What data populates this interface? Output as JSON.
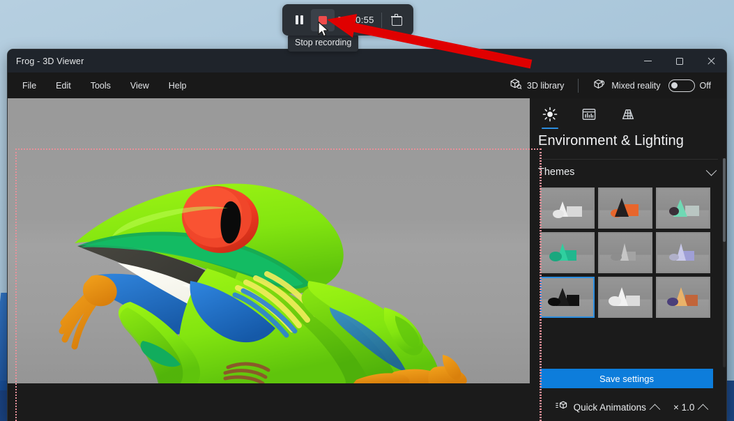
{
  "recording_toolbar": {
    "pause_label": "Pause recording",
    "stop_label": "Stop recording",
    "timer": "00:00:55",
    "delete_label": "Delete recording",
    "tooltip": "Stop recording",
    "accent_red": "#ef4b4b"
  },
  "window": {
    "title": "Frog - 3D Viewer",
    "minimize_label": "Minimize",
    "maximize_label": "Maximize",
    "close_label": "Close"
  },
  "menubar": {
    "items": [
      {
        "label": "File"
      },
      {
        "label": "Edit"
      },
      {
        "label": "Tools"
      },
      {
        "label": "View"
      },
      {
        "label": "Help"
      }
    ],
    "library_label": "3D library",
    "mixed_reality_label": "Mixed reality",
    "mixed_reality_state": "Off"
  },
  "side_panel": {
    "tabs": [
      {
        "name": "environment-lighting",
        "icon": "sun-icon",
        "active": true
      },
      {
        "name": "statistics",
        "icon": "panel-stats-icon",
        "active": false
      },
      {
        "name": "grid",
        "icon": "grid-icon",
        "active": false
      }
    ],
    "heading": "Environment & Lighting",
    "themes_label": "Themes",
    "themes": [
      {
        "id": 1,
        "selected": false
      },
      {
        "id": 2,
        "selected": false
      },
      {
        "id": 3,
        "selected": false
      },
      {
        "id": 4,
        "selected": false
      },
      {
        "id": 5,
        "selected": false
      },
      {
        "id": 6,
        "selected": false
      },
      {
        "id": 7,
        "selected": true
      },
      {
        "id": 8,
        "selected": false
      },
      {
        "id": 9,
        "selected": false
      }
    ],
    "save_settings_label": "Save settings",
    "quick_animations_label": "Quick Animations",
    "speed_label": "× 1.0",
    "accent_blue": "#0d7ddb"
  },
  "viewport": {
    "model_name": "Frog",
    "background_color": "#9a9a9a"
  },
  "annotation": {
    "arrow_color": "#e00000"
  }
}
